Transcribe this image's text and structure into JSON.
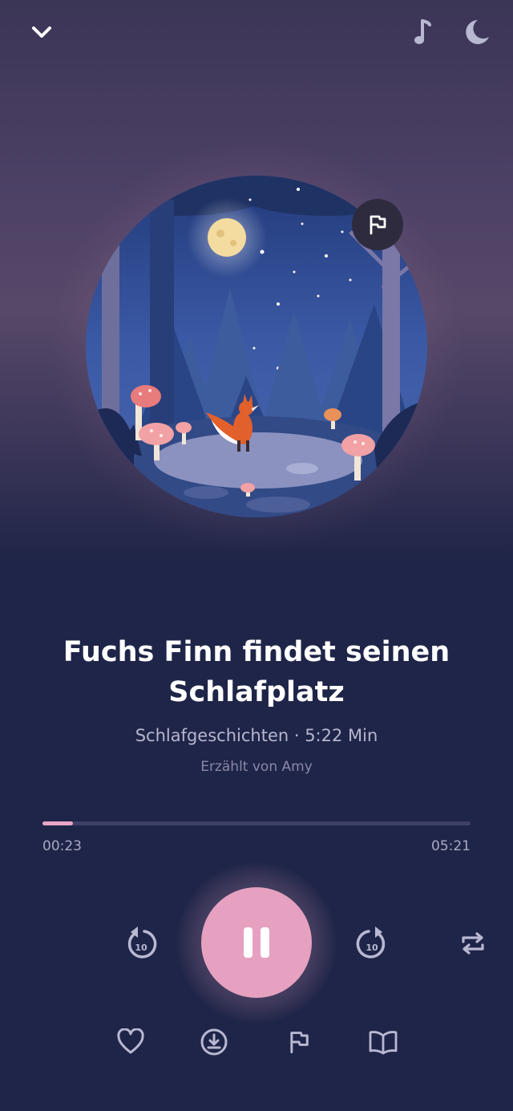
{
  "header": {
    "collapse_icon": "chevron-down-icon",
    "music_icon": "music-note-icon",
    "sleep_icon": "moon-icon"
  },
  "cover": {
    "badge_icon": "flag-icon"
  },
  "track": {
    "title": "Fuchs Finn findet seinen Schlafplatz",
    "meta": "Schlafgeschichten · 5:22 Min",
    "narrator": "Erzählt von Amy"
  },
  "playback": {
    "elapsed": "00:23",
    "remaining": "05:21",
    "progress_fraction": 0.072,
    "skip_back_label": "10",
    "skip_forward_label": "10",
    "state": "playing"
  },
  "actions": {
    "favorite_icon": "heart-icon",
    "download_icon": "download-icon",
    "report_icon": "flag-icon",
    "read_icon": "open-book-icon"
  },
  "colors": {
    "background": "#1f2548",
    "accent": "#e6a1c1",
    "icon_muted": "#b9b8d2"
  }
}
